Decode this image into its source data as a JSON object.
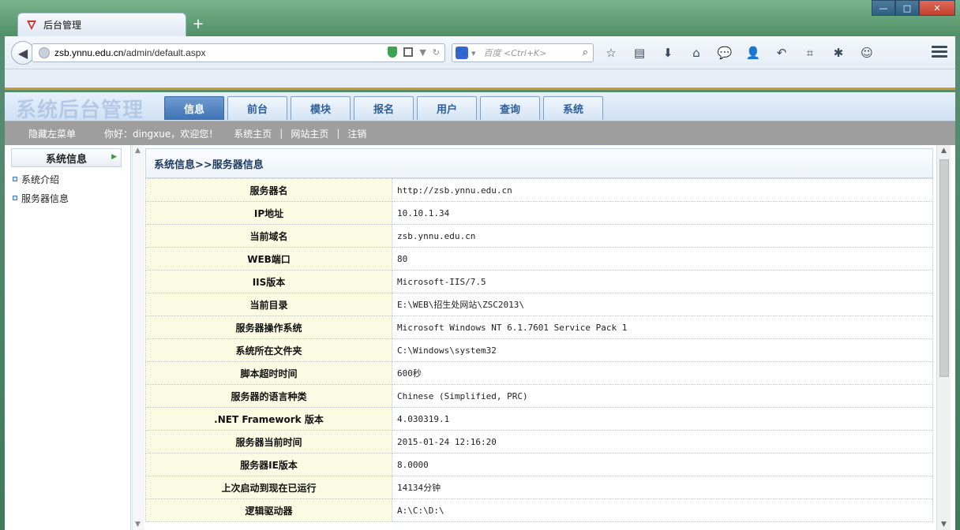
{
  "browser": {
    "tab_title": "后台管理",
    "new_tab": "+",
    "url_host": "zsb.ynnu.edu.cn",
    "url_path": "/admin/default.aspx",
    "search_placeholder": "百度 <Ctrl+K>",
    "window_controls": {
      "minimize": "—",
      "maximize": "□",
      "close": "✕"
    },
    "toolbar_icons": [
      "star-icon",
      "reading-list-icon",
      "download-icon",
      "home-icon",
      "chat-icon",
      "person-icon",
      "undo-icon",
      "crop-icon",
      "bug-icon",
      "emoji-icon",
      "menu-icon"
    ]
  },
  "site": {
    "title": "系统后台管理",
    "main_tabs": [
      "信息",
      "前台",
      "模块",
      "报名",
      "用户",
      "查询",
      "系统"
    ],
    "active_tab": "信息"
  },
  "subnav": {
    "hide_menu": "隐藏左菜单",
    "greeting": "你好：dingxue，欢迎您！",
    "links": [
      "系统主页",
      "网站主页",
      "注销"
    ],
    "separator": "|"
  },
  "sidebar": {
    "header": "系统信息",
    "items": [
      "系统介绍",
      "服务器信息"
    ]
  },
  "content": {
    "breadcrumb": "系统信息>>服务器信息",
    "rows": [
      {
        "key": "服务器名",
        "value": "http://zsb.ynnu.edu.cn"
      },
      {
        "key": "IP地址",
        "value": "10.10.1.34"
      },
      {
        "key": "当前域名",
        "value": "zsb.ynnu.edu.cn"
      },
      {
        "key": "WEB端口",
        "value": "80"
      },
      {
        "key": "IIS版本",
        "value": "Microsoft-IIS/7.5"
      },
      {
        "key": "当前目录",
        "value": "E:\\WEB\\招生处网站\\ZSC2013\\"
      },
      {
        "key": "服务器操作系统",
        "value": "Microsoft Windows NT 6.1.7601 Service Pack 1"
      },
      {
        "key": "系统所在文件夹",
        "value": "C:\\Windows\\system32"
      },
      {
        "key": "脚本超时时间",
        "value": "600秒"
      },
      {
        "key": "服务器的语言种类",
        "value": "Chinese (Simplified, PRC)"
      },
      {
        "key": ".NET Framework 版本",
        "value": "4.030319.1"
      },
      {
        "key": "服务器当前时间",
        "value": "2015-01-24 12:16:20"
      },
      {
        "key": "服务器IE版本",
        "value": "8.0000"
      },
      {
        "key": "上次启动到现在已运行",
        "value": "14134分钟"
      },
      {
        "key": "逻辑驱动器",
        "value": "A:\\C:\\D:\\"
      }
    ]
  }
}
